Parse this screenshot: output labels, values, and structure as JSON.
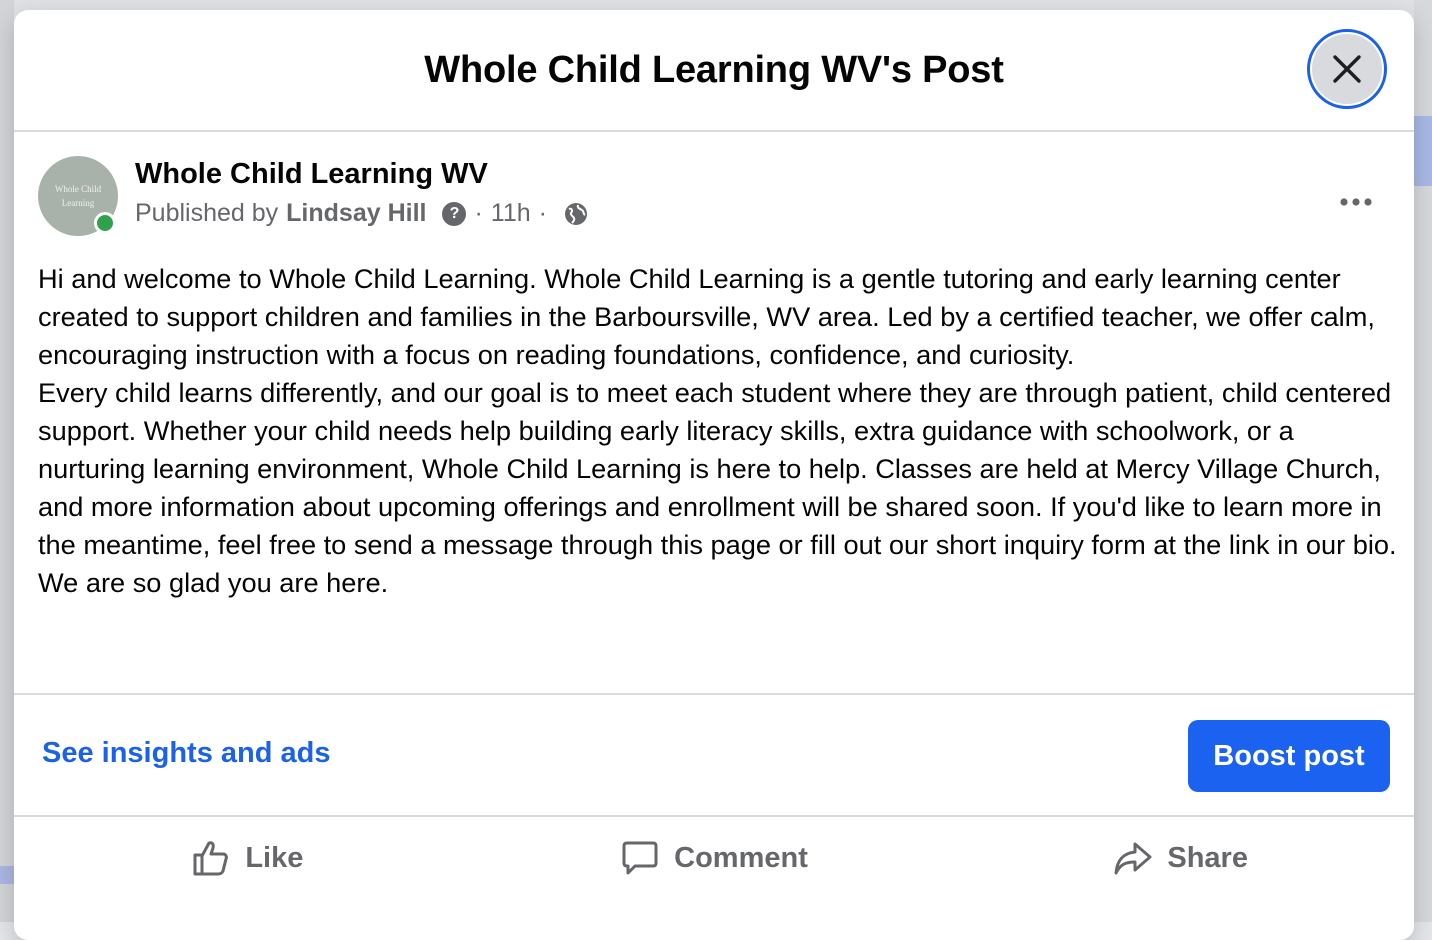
{
  "modal": {
    "title": "Whole Child Learning WV's Post"
  },
  "post": {
    "avatar_text": "Whole Child Learning",
    "page_name": "Whole Child Learning WV",
    "published_by_label": "Published by",
    "publisher": "Lindsay Hill",
    "help_glyph": "?",
    "separator": "·",
    "time": "11h",
    "audience_icon": "globe-icon",
    "paragraphs": [
      "Hi and welcome to Whole Child Learning. Whole Child Learning is a gentle tutoring and early learning center created to support children and families in the Barboursville, WV area. Led by a certified teacher, we offer calm, encouraging instruction with a focus on reading foundations, confidence, and curiosity.",
      "Every child learns differently, and our goal is to meet each student where they are through patient, child centered support. Whether your child needs help building early literacy skills, extra guidance with schoolwork, or a nurturing learning environment, Whole Child Learning is here to help. Classes are held at Mercy Village Church, and more information about upcoming offerings and enrollment will be shared soon. If you'd like to learn more in the meantime, feel free to send a message through this page or fill out our short inquiry form at the link in our bio. We are so glad you are here."
    ]
  },
  "footer": {
    "insights_link": "See insights and ads",
    "boost_button": "Boost post"
  },
  "actions": {
    "like": "Like",
    "comment": "Comment",
    "share": "Share"
  },
  "colors": {
    "accent": "#1b62e6",
    "online": "#31a24c",
    "muted_text": "#65676b"
  }
}
